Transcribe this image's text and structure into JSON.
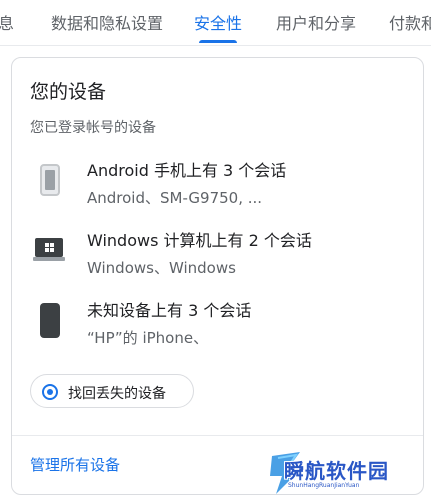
{
  "tabs": {
    "items": [
      {
        "label": "息"
      },
      {
        "label": "数据和隐私设置"
      },
      {
        "label": "安全性"
      },
      {
        "label": "用户和分享"
      },
      {
        "label": "付款和"
      }
    ],
    "active_index": 2
  },
  "devices_card": {
    "title": "您的设备",
    "subtitle": "您已登录帐号的设备",
    "devices": [
      {
        "title": "Android 手机上有 3 个会话",
        "subtitle": "Android、SM-G9750, ...",
        "icon": "android-phone-icon"
      },
      {
        "title": "Windows 计算机上有 2 个会话",
        "subtitle": "Windows、Windows",
        "icon": "windows-laptop-icon"
      },
      {
        "title": "未知设备上有 3 个会话",
        "subtitle": "“HP”的 iPhone、",
        "icon": "unknown-phone-icon"
      }
    ],
    "find_button": {
      "label": "找回丢失的设备",
      "icon": "locate-icon"
    },
    "manage_link": "管理所有设备"
  },
  "watermark": {
    "text": "瞬航软件园",
    "subtext": "ShunHangRuanJianYuan"
  },
  "colors": {
    "accent": "#1a73e8",
    "text_primary": "#202124",
    "text_secondary": "#5f6368",
    "border": "#dadce0",
    "watermark": "#2a57c6"
  }
}
